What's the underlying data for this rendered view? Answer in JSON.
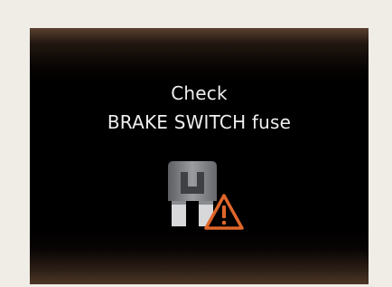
{
  "screen": {
    "message_line1": "Check",
    "message_line2": "BRAKE SWITCH fuse",
    "icons": [
      "fuse-icon",
      "warning-triangle-icon"
    ]
  },
  "colors": {
    "background": "#efede6",
    "display": "#000000",
    "display_edge_glow": "#5a4030",
    "text": "#efefef",
    "fuse_body": "#8a8c90",
    "warning_accent": "#e0662a"
  }
}
